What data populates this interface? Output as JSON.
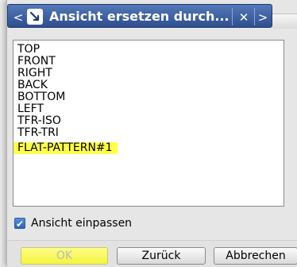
{
  "dialog": {
    "title": "Ansicht ersetzen durch...",
    "nav_prev_glyph": "<",
    "pin_glyph": "➘",
    "close_glyph": "✕",
    "nav_next_glyph": ">"
  },
  "view_list": {
    "items": [
      "TOP",
      "FRONT",
      "RIGHT",
      "BACK",
      "BOTTOM",
      "LEFT",
      "TFR-ISO",
      "TFR-TRI",
      "FLAT-PATTERN#1"
    ],
    "highlighted_item": "FLAT-PATTERN#1",
    "highlight_color": "#ffff4d"
  },
  "fit_view": {
    "label": "Ansicht einpassen",
    "checked": true,
    "check_glyph": "✔"
  },
  "buttons": {
    "ok": "OK",
    "back": "Zurück",
    "cancel": "Abbrechen"
  },
  "colors": {
    "title_bar": "#3e5f9f",
    "checkbox_accent": "#2c63b5"
  },
  "icons": {
    "prev": "chevron-left-icon",
    "pin": "pin-icon",
    "close": "close-icon",
    "next": "chevron-right-icon",
    "check": "checkmark-icon"
  }
}
